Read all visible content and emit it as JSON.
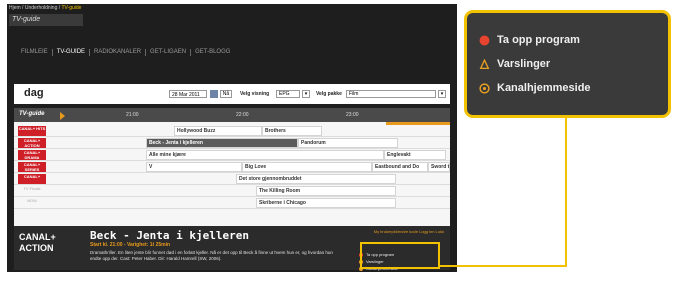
{
  "breadcrumb": {
    "path": "Hjem / Underholdning / ",
    "current": "TV-guide"
  },
  "section_title": "TV-guide",
  "nav": [
    "FILMLEIE",
    "TV-GUIDE",
    "RADIOKANALER",
    "GET-LIGAEN",
    "GET-BLOGG"
  ],
  "daybar": {
    "day": "dag",
    "date": "28 Mar 2011",
    "go": "Nå",
    "sort_label": "Velg visning",
    "sort_value": "EPG",
    "package_label": "Velg pakke",
    "package_value": "Film"
  },
  "grid": {
    "header": "TV-guide",
    "times": [
      "21:00",
      "22:00",
      "23:00"
    ],
    "channels": [
      {
        "logo": "CANAL+ HITS",
        "programs": [
          "Hollywood Buzz",
          "Brothers"
        ]
      },
      {
        "logo": "CANAL+ ACTION",
        "programs": [
          "Beck - Jenta i kjelleren",
          "Pandorum"
        ]
      },
      {
        "logo": "CANAL+ DRAMA",
        "programs": [
          "Alle mine kjære",
          "Englevakt"
        ]
      },
      {
        "logo": "CANAL+ SERIES",
        "programs": [
          "V",
          "Big Love",
          "Eastbound and Do",
          "Sword t"
        ]
      },
      {
        "logo": "CANAL+",
        "programs": [
          "Det store gjennombruddet"
        ]
      },
      {
        "logo": "TV Finale",
        "programs": [
          "The Killing Room"
        ]
      },
      {
        "logo": "NOW",
        "programs": [
          "Skriberne i Chicago"
        ]
      }
    ]
  },
  "info": {
    "channel_line1": "CANAL+",
    "channel_line2": "ACTION",
    "title": "Beck - Jenta i kjelleren",
    "start": "Start kl. 21:00 - Varighet: 1t 25min",
    "description": "Dramathriller. En liten jente blir funnet død i en forlatt kjeller. Nå er det opp til Beck å finne ut hvem hun er, og hvordan hun endte opp der. Cast: Peter Haber. Dir: Harald Hamrell (SW, 2006).",
    "links": "My brukerpkt/endre kode  Logg inn  Lukk"
  },
  "actions": [
    "Ta opp program",
    "Varslinger",
    "Kanalhjemmeside"
  ],
  "colors": {
    "accent": "#f2c200",
    "record": "#e8432e",
    "orange": "#e89a1e"
  }
}
